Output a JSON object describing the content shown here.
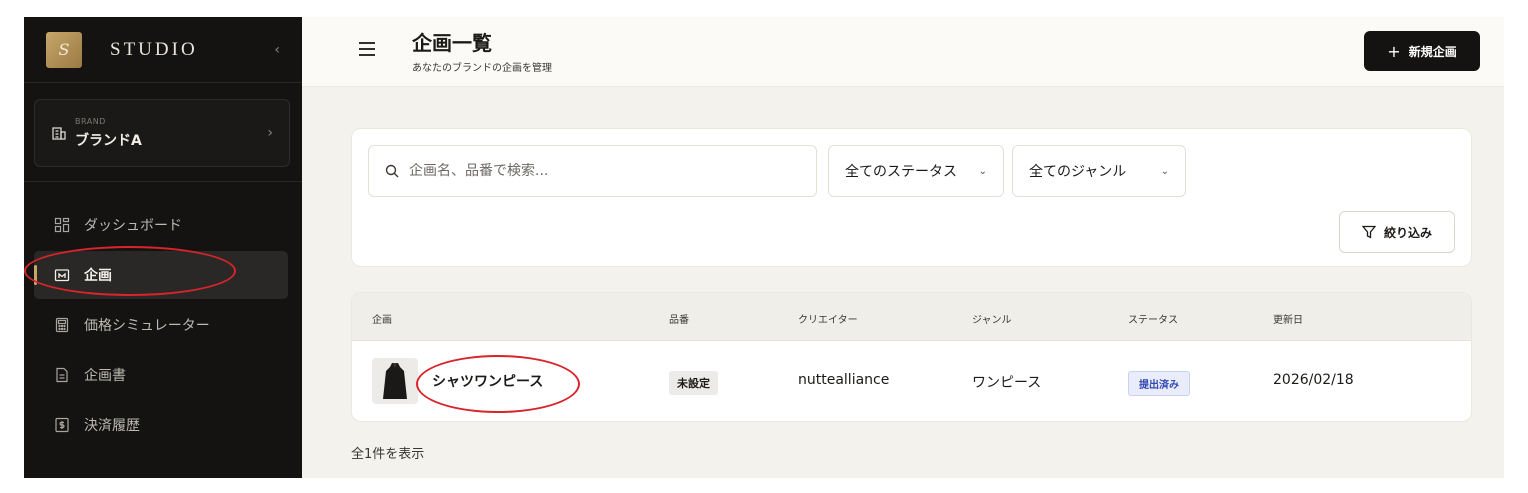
{
  "sidebar": {
    "logo_letter": "S",
    "app_name": "STUDIO",
    "collapse_glyph": "‹",
    "brand": {
      "label": "BRAND",
      "name": "ブランドA"
    },
    "items": [
      {
        "label": "ダッシュボード",
        "icon": "dashboard-icon",
        "active": false
      },
      {
        "label": "企画",
        "icon": "folder-icon",
        "active": true
      },
      {
        "label": "価格シミュレーター",
        "icon": "calculator-icon",
        "active": false
      },
      {
        "label": "企画書",
        "icon": "document-icon",
        "active": false
      },
      {
        "label": "決済履歴",
        "icon": "receipt-icon",
        "active": false
      }
    ]
  },
  "header": {
    "title": "企画一覧",
    "subtitle": "あなたのブランドの企画を管理",
    "new_button": "新規企画"
  },
  "filters": {
    "search_placeholder": "企画名、品番で検索...",
    "status_select": "全てのステータス",
    "genre_select": "全てのジャンル",
    "filter_button": "絞り込み"
  },
  "table": {
    "columns": [
      "企画",
      "品番",
      "クリエイター",
      "ジャンル",
      "ステータス",
      "更新日"
    ],
    "rows": [
      {
        "name": "シャツワンピース",
        "sku": "未設定",
        "creator": "nuttealliance",
        "genre": "ワンピース",
        "status": "提出済み",
        "updated": "2026/02/18"
      }
    ]
  },
  "footer": {
    "count_text": "全1件を表示"
  },
  "colors": {
    "accent_gold": "#c7a66a",
    "annotation_red": "#d8242a",
    "status_blue": "#3447b2"
  }
}
